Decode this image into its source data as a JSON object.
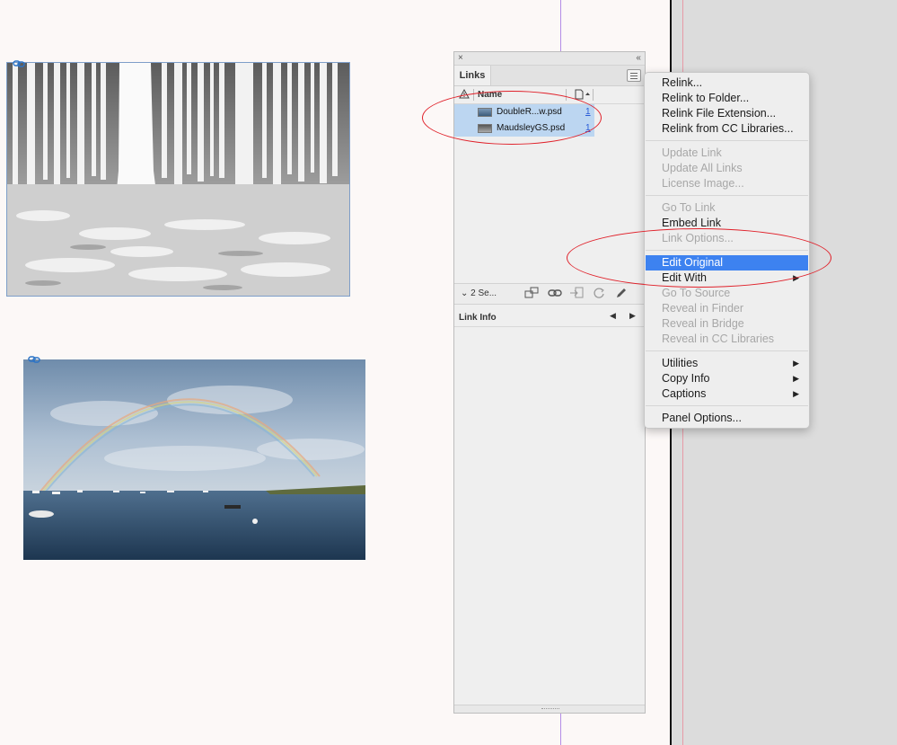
{
  "panel": {
    "tab_label": "Links",
    "close_glyph": "×",
    "collapse_glyph": "‹‹",
    "column_name": "Name",
    "links": [
      {
        "name": "DoubleR...w.psd",
        "page": "1"
      },
      {
        "name": "MaudsleyGS.psd",
        "page": "1"
      }
    ],
    "selection_count": "2 Se...",
    "info_title": "Link Info",
    "prev_glyph": "◀",
    "next_glyph": "▶"
  },
  "menu": {
    "items": [
      {
        "label": "Relink...",
        "state": "enabled"
      },
      {
        "label": "Relink to Folder...",
        "state": "enabled"
      },
      {
        "label": "Relink File Extension...",
        "state": "enabled"
      },
      {
        "label": "Relink from CC Libraries...",
        "state": "enabled"
      },
      {
        "label": "Update Link",
        "state": "disabled"
      },
      {
        "label": "Update All Links",
        "state": "disabled"
      },
      {
        "label": "License Image...",
        "state": "disabled"
      },
      {
        "label": "Go To Link",
        "state": "disabled"
      },
      {
        "label": "Embed Link",
        "state": "enabled"
      },
      {
        "label": "Link Options...",
        "state": "disabled"
      },
      {
        "label": "Edit Original",
        "state": "highlighted"
      },
      {
        "label": "Edit With",
        "state": "enabled",
        "submenu": true
      },
      {
        "label": "Go To Source",
        "state": "disabled"
      },
      {
        "label": "Reveal in Finder",
        "state": "disabled"
      },
      {
        "label": "Reveal in Bridge",
        "state": "disabled"
      },
      {
        "label": "Reveal in CC Libraries",
        "state": "disabled"
      },
      {
        "label": "Utilities",
        "state": "enabled",
        "submenu": true
      },
      {
        "label": "Copy Info",
        "state": "enabled",
        "submenu": true
      },
      {
        "label": "Captions",
        "state": "enabled",
        "submenu": true
      },
      {
        "label": "Panel Options...",
        "state": "enabled"
      }
    ],
    "submenu_glyph": "▶",
    "highlight_color": "#3d82f0"
  },
  "colors": {
    "annotation": "#e0212a",
    "selection": "#bcd6f1",
    "guide": "#b48ce6"
  }
}
